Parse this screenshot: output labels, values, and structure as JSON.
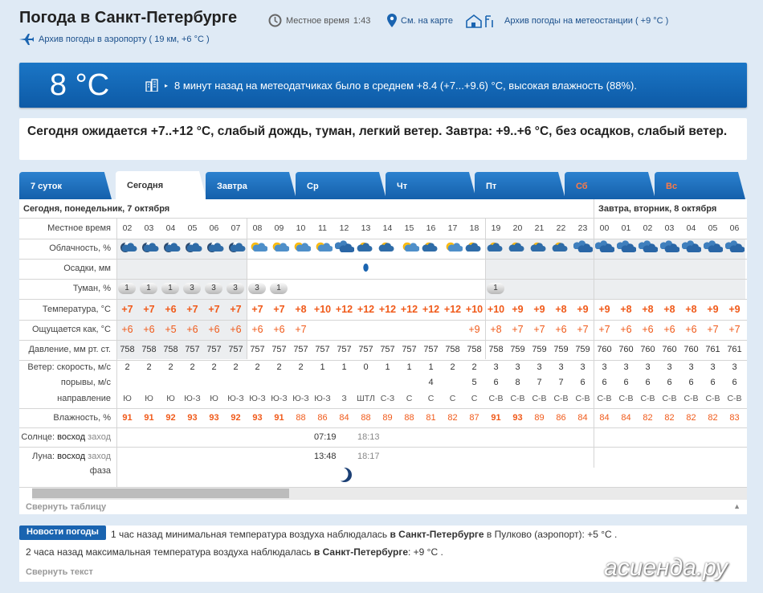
{
  "header": {
    "title": "Погода в Санкт-Петербурге",
    "local_time_label": "Местное время",
    "local_time": "1:43",
    "map_link": "См. на карте",
    "station_archive": "Архив погоды на метеостанции ( +9 °C )",
    "airport_archive": "Архив погоды в аэропорту ( 19 км, +6 °C )"
  },
  "current": {
    "temp": "8 °C",
    "text": "8 минут назад на метеодатчиках было в среднем +8.4 (+7...+9.6) °C, высокая влажность (88%)."
  },
  "forecast_summary": "Сегодня ожидается +7..+12 °C, слабый дождь, туман, легкий ветер. Завтра: +9..+6 °C, без осадков, слабый ветер.",
  "tabs": [
    {
      "label": "7 суток",
      "active": false,
      "weekend": false
    },
    {
      "label": "Сегодня",
      "active": true,
      "weekend": false
    },
    {
      "label": "Завтра",
      "active": false,
      "weekend": false
    },
    {
      "label": "Ср",
      "active": false,
      "weekend": false
    },
    {
      "label": "Чт",
      "active": false,
      "weekend": false
    },
    {
      "label": "Пт",
      "active": false,
      "weekend": false
    },
    {
      "label": "Сб",
      "active": false,
      "weekend": true
    },
    {
      "label": "Вс",
      "active": false,
      "weekend": true
    }
  ],
  "help_label": "?",
  "table": {
    "day1_header": "Сегодня, понедельник, 7 октября",
    "day2_header": "Завтра, вторник, 8 октября",
    "row_labels": {
      "time": "Местное время",
      "cloud": "Облачность, %",
      "precip": "Осадки, мм",
      "fog": "Туман, %",
      "temp": "Температура, °С",
      "felt": "Ощущается как, °С",
      "pressure": "Давление, мм рт. ст.",
      "wind": "Ветер: скорость, м/с",
      "gusts": "порывы, м/с",
      "direction": "направление",
      "humidity": "Влажность, %",
      "sun_prefix": "Солнце:",
      "sun_rise": "восход",
      "sun_set": "заход",
      "moon_prefix": "Луна:",
      "moon_rise": "восход",
      "moon_set": "заход",
      "moon_phase": "фаза"
    },
    "hours": [
      "02",
      "03",
      "04",
      "05",
      "06",
      "07",
      "08",
      "09",
      "10",
      "11",
      "12",
      "13",
      "14",
      "15",
      "16",
      "17",
      "18",
      "19",
      "20",
      "21",
      "22",
      "23",
      "00",
      "01",
      "02",
      "03",
      "04",
      "05",
      "06"
    ],
    "cloud_icons": [
      "night-cloud",
      "night-cloud",
      "night-cloud",
      "night-cloud",
      "night-cloud",
      "night-cloud",
      "sun-cloud",
      "sun-cloud",
      "sun-cloud",
      "sun-cloud",
      "rain-cloud",
      "cloud",
      "cloud",
      "sun-cloud",
      "cloud",
      "sun-cloud",
      "cloud",
      "cloud",
      "cloud",
      "cloud",
      "cloud",
      "overcast",
      "overcast",
      "overcast",
      "overcast",
      "overcast",
      "overcast",
      "overcast",
      "overcast"
    ],
    "precip_drop_index": 11,
    "fog": [
      "1",
      "1",
      "1",
      "3",
      "3",
      "3",
      "3",
      "1",
      "",
      "",
      "",
      "",
      "",
      "",
      "",
      "",
      "",
      "1",
      "",
      "",
      "",
      "",
      "",
      "",
      "",
      "",
      "",
      "",
      ""
    ],
    "temp": [
      "+7",
      "+7",
      "+6",
      "+7",
      "+7",
      "+7",
      "+7",
      "+7",
      "+8",
      "+10",
      "+12",
      "+12",
      "+12",
      "+12",
      "+12",
      "+12",
      "+10",
      "+10",
      "+9",
      "+9",
      "+8",
      "+9",
      "+9",
      "+8",
      "+8",
      "+8",
      "+8",
      "+9",
      "+9"
    ],
    "felt": [
      "+6",
      "+6",
      "+5",
      "+6",
      "+6",
      "+6",
      "+6",
      "+6",
      "+7",
      "",
      "",
      "",
      "",
      "",
      "",
      "",
      "+9",
      "+8",
      "+7",
      "+7",
      "+6",
      "+7",
      "+7",
      "+6",
      "+6",
      "+6",
      "+6",
      "+7",
      "+7"
    ],
    "pressure": [
      "758",
      "758",
      "758",
      "757",
      "757",
      "757",
      "757",
      "757",
      "757",
      "757",
      "757",
      "757",
      "757",
      "757",
      "757",
      "758",
      "758",
      "758",
      "759",
      "759",
      "759",
      "759",
      "760",
      "760",
      "760",
      "760",
      "760",
      "761",
      "761"
    ],
    "wind": [
      "2",
      "2",
      "2",
      "2",
      "2",
      "2",
      "2",
      "2",
      "2",
      "1",
      "1",
      "0",
      "1",
      "1",
      "1",
      "2",
      "2",
      "3",
      "3",
      "3",
      "3",
      "3",
      "3",
      "3",
      "3",
      "3",
      "3",
      "3",
      "3"
    ],
    "gusts": [
      "",
      "",
      "",
      "",
      "",
      "",
      "",
      "",
      "",
      "",
      "",
      "",
      "",
      "",
      "4",
      "",
      "5",
      "6",
      "8",
      "7",
      "7",
      "6",
      "6",
      "6",
      "6",
      "6",
      "6",
      "6",
      "6"
    ],
    "direction": [
      "Ю",
      "Ю",
      "Ю",
      "Ю-З",
      "Ю",
      "Ю-З",
      "Ю-З",
      "Ю-З",
      "Ю-З",
      "Ю-З",
      "З",
      "ШТЛ",
      "С-З",
      "С",
      "С",
      "С",
      "С",
      "С-В",
      "С-В",
      "С-В",
      "С-В",
      "С-В",
      "С-В",
      "С-В",
      "С-В",
      "С-В",
      "С-В",
      "С-В",
      "С-В"
    ],
    "humidity": [
      "91",
      "91",
      "92",
      "93",
      "93",
      "92",
      "93",
      "91",
      "88",
      "86",
      "84",
      "88",
      "89",
      "88",
      "81",
      "82",
      "87",
      "91",
      "93",
      "89",
      "86",
      "84",
      "84",
      "84",
      "82",
      "82",
      "82",
      "82",
      "83"
    ],
    "humidity_bold": [
      true,
      true,
      true,
      true,
      true,
      true,
      true,
      true,
      false,
      false,
      false,
      false,
      false,
      false,
      false,
      false,
      false,
      true,
      true,
      false,
      false,
      false,
      false,
      false,
      false,
      false,
      false,
      false,
      false
    ],
    "sunrise": "07:19",
    "sunset": "18:13",
    "moonrise": "13:48",
    "moonset": "18:17",
    "collapse_label": "Свернуть таблицу"
  },
  "news": {
    "badge": "Новости погоды",
    "line1_pre": "1 час назад минимальная температура воздуха наблюдалась ",
    "line1_city": "в Санкт-Петербурге",
    "line1_post": " в Пулково (аэропорт): +5 °С .",
    "line2_pre": "2 часа назад максимальная температура воздуха наблюдалась ",
    "line2_city": "в Санкт-Петербурге",
    "line2_post": ": +9 °С .",
    "collapse_label": "Свернуть текст"
  },
  "watermark": "асиенда.ру",
  "colors": {
    "accent_blue": "#1460ab",
    "temp_orange": "#f05a1a",
    "weekend_tab": "#ff7a45"
  }
}
